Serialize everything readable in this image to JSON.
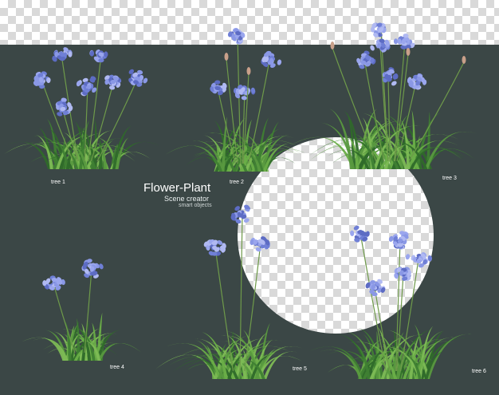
{
  "scene": {
    "title": "Flower-Plant",
    "subtitle": "Scene creator",
    "caption": "smart objects"
  },
  "labels": {
    "tree1": "tree 1",
    "tree2": "tree 2",
    "tree3": "tree 3",
    "tree4": "tree 4",
    "tree5": "tree 5",
    "tree6": "tree 6"
  },
  "colors": {
    "background": "#3b4746",
    "flower": "#7f8fe0",
    "leaf": "#4d8f3a",
    "checker_light": "#ffffff",
    "checker_dark": "#d9d9d9"
  }
}
